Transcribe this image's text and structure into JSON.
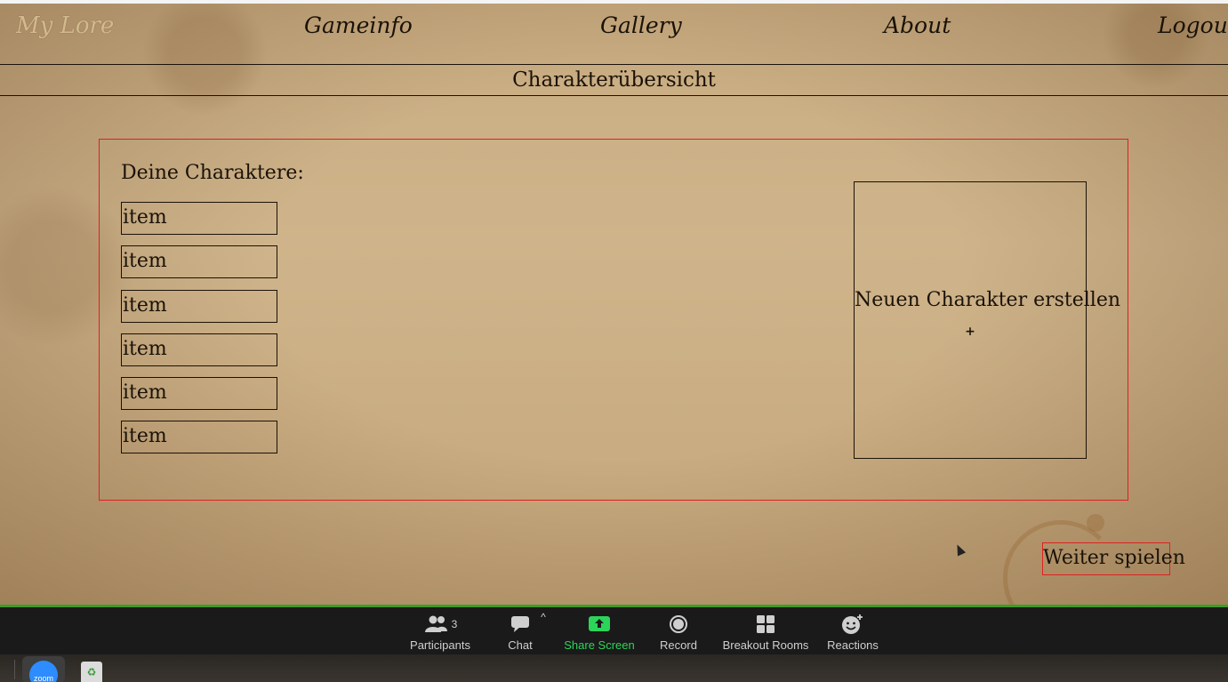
{
  "nav": {
    "brand": "My Lore",
    "items": [
      {
        "label": "Gameinfo"
      },
      {
        "label": "Gallery"
      },
      {
        "label": "About"
      },
      {
        "label": "Logout"
      }
    ]
  },
  "page_title": "Charakterübersicht",
  "characters": {
    "heading": "Deine Charaktere:",
    "items": [
      "item",
      "item",
      "item",
      "item",
      "item",
      "item"
    ]
  },
  "new_character": {
    "label": "Neuen Charakter erstellen",
    "plus": "+"
  },
  "continue_label": "Weiter spielen",
  "zoom_toolbar": {
    "participants_label": "Participants",
    "participants_count": "3",
    "chat_label": "Chat",
    "share_label": "Share Screen",
    "record_label": "Record",
    "breakout_label": "Breakout Rooms",
    "reactions_label": "Reactions",
    "share_color": "#2dd45a"
  },
  "taskbar": {
    "zoom_app_label": "zoom"
  },
  "colors": {
    "accent_border": "#e02020",
    "zoom_green": "#3d9b2a",
    "ink": "#1a1208"
  }
}
